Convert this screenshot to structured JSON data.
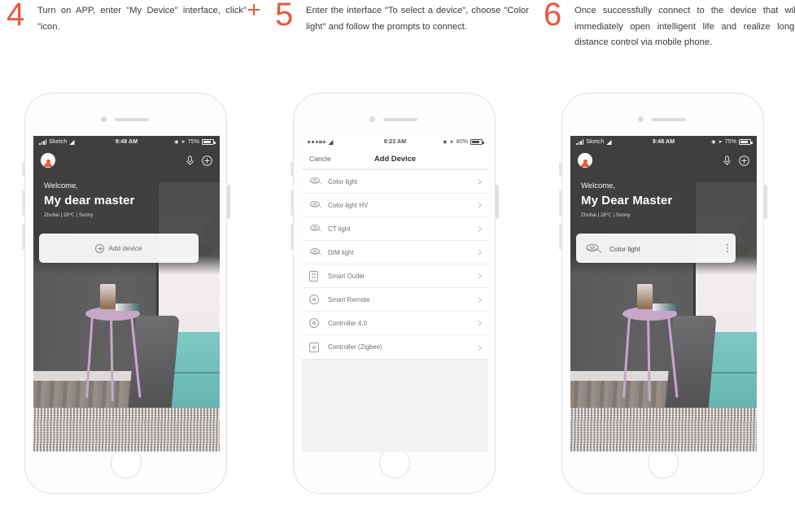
{
  "steps": [
    {
      "number": "4",
      "text_before": "Turn on APP, enter \"My Device\" interface, click\"",
      "icon": "plus-icon",
      "text_after": "\"icon."
    },
    {
      "number": "5",
      "text": "Enter the interface \"To select a device\", choose \"Color light\" and follow the prompts to connect."
    },
    {
      "number": "6",
      "text": "Once successfully connect to the device that will immediately open intelligent life and realize long-distance control via mobile phone."
    }
  ],
  "phone1": {
    "statusbar": {
      "carrier": "Sketch",
      "time": "9:48 AM",
      "battery": "75%"
    },
    "welcome_small": "Welcome,",
    "welcome_large": "My dear master",
    "meta": "Zhuhai | 28℃ | Sunny",
    "add_device_label": "Add device",
    "icons": {
      "avatar": "user-avatar-icon",
      "mic": "microphone-icon",
      "add": "plus-circle-icon"
    }
  },
  "phone2": {
    "statusbar": {
      "carrier": "",
      "time": "8:23 AM",
      "battery": "80%"
    },
    "nav": {
      "cancel": "Cancle",
      "title": "Add Device"
    },
    "devices": [
      {
        "label": "Color light",
        "icon": "led-strip-icon"
      },
      {
        "label": "Color light HV",
        "icon": "led-strip-icon"
      },
      {
        "label": "CT light",
        "icon": "led-strip-icon"
      },
      {
        "label": "DIM light",
        "icon": "led-strip-icon"
      },
      {
        "label": "Smart Outlet",
        "icon": "outlet-icon"
      },
      {
        "label": "Smart Remote",
        "icon": "remote-circle-icon"
      },
      {
        "label": "Controller 4.0",
        "icon": "remote-circle-icon"
      },
      {
        "label": "Controller (Zigbee)",
        "icon": "controller-square-icon"
      }
    ]
  },
  "phone3": {
    "statusbar": {
      "carrier": "Sketch",
      "time": "9:48 AM",
      "battery": "75%"
    },
    "welcome_small": "Welcome,",
    "welcome_large": "My Dear Master",
    "meta": "Zhuhai | 28℃ | Sunny",
    "device_card": {
      "label": "Color light",
      "icon": "led-strip-icon",
      "more": "more-vertical-icon"
    }
  },
  "colors": {
    "step_number": "#e8593c",
    "accent_red": "#e8402a",
    "avatar_orange": "#f05a2d",
    "screen_dark": "#5a5a5a",
    "list_bg": "#f2f2f2"
  }
}
